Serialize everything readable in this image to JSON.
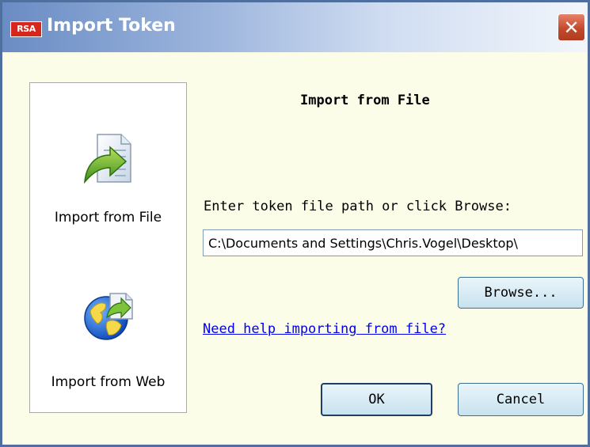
{
  "window": {
    "title": "Import Token",
    "logo_text": "RSA",
    "close_glyph": "✕"
  },
  "sidebar": {
    "items": [
      {
        "label": "Import from File",
        "icon": "import-file-icon"
      },
      {
        "label": "Import from Web",
        "icon": "import-web-icon"
      }
    ]
  },
  "main": {
    "heading": "Import from File",
    "prompt": "Enter token file path or click Browse:",
    "path_value": "C:\\Documents and Settings\\Chris.Vogel\\Desktop\\",
    "browse_label": "Browse...",
    "help_link": "Need help importing from file?",
    "ok_label": "OK",
    "cancel_label": "Cancel"
  },
  "colors": {
    "titlebar_start": "#6a8cc4",
    "background": "#fcfde8",
    "link": "#0000ee",
    "close": "#c54a2c"
  }
}
